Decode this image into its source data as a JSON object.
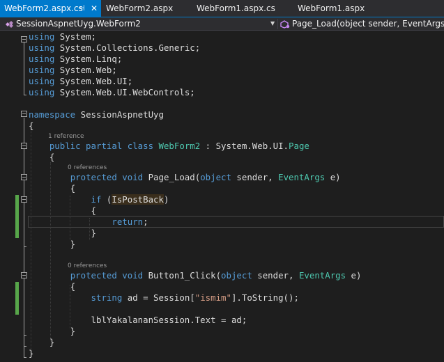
{
  "colors": {
    "accent": "#007acc",
    "keyword": "#569cd6",
    "type": "#4ec9b0",
    "string": "#d69d85",
    "plain": "#dcdcdc",
    "codelens": "#999999",
    "change_bar": "#57a64a"
  },
  "tabs": [
    {
      "label": "WebForm2.aspx.cs",
      "active": true,
      "pin_icon": "pin-icon",
      "close_icon": "close-icon"
    },
    {
      "label": "WebForm2.aspx",
      "active": false
    },
    {
      "label": "WebForm1.aspx.cs",
      "active": false
    },
    {
      "label": "WebForm1.aspx",
      "active": false
    }
  ],
  "navbar": {
    "type_icon": "class-icon",
    "type_selector": "SessionAspnetUyg.WebForm2",
    "member_icon": "method-icon",
    "member_selector": "Page_Load(object sender, EventArgs e)"
  },
  "codelens": {
    "class_refs": "1 reference",
    "page_load_refs": "0 references",
    "button_click_refs": "0 references"
  },
  "code": {
    "using_kw": "using",
    "using_1": "System;",
    "using_2": "System.Collections.Generic;",
    "using_3": "System.Linq;",
    "using_4": "System.Web;",
    "using_5": "System.Web.UI;",
    "using_6": "System.Web.UI.WebControls;",
    "namespace_kw": "namespace",
    "namespace_name": "SessionAspnetUyg",
    "open_brace": "{",
    "close_brace": "}",
    "class_modifiers": "public partial class",
    "class_name": "WebForm2",
    "class_colon": " : System.Web.UI.",
    "class_base": "Page",
    "method_modifiers": "protected void",
    "page_load_name": "Page_Load(",
    "object_kw": "object",
    "sender_part": " sender, ",
    "eventargs_type": "EventArgs",
    "e_part": " e)",
    "if_kw": "if",
    "if_open": " (",
    "ispostback": "IsPostBack",
    "if_close": ")",
    "return_kw": "return",
    "semicolon": ";",
    "button_click_name": "Button1_Click(",
    "string_kw": "string",
    "assign_part": " ad = Session[",
    "session_key": "\"ismim\"",
    "tostring_part": "].ToString();",
    "label_assign": "lblYakalananSession.Text = ad;"
  }
}
